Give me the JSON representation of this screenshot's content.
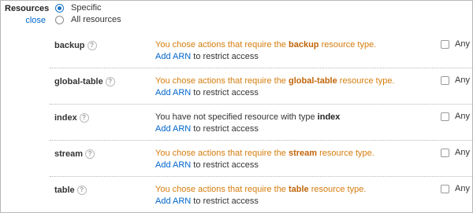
{
  "resources": {
    "label": "Resources",
    "close_label": "close",
    "options": [
      {
        "label": "Specific",
        "selected": true
      },
      {
        "label": "All resources",
        "selected": false
      }
    ],
    "help_glyph": "?",
    "add_arn_label": "Add ARN",
    "add_arn_suffix": " to restrict access",
    "any_label": "Any",
    "colors": {
      "warning_text": "#d57c0d",
      "link": "#0066cc",
      "radio_accent": "#1a73c8"
    },
    "rows": [
      {
        "name": "backup",
        "type": "warning",
        "msg_pre": "You chose actions that require the ",
        "msg_bold": "backup",
        "msg_post": " resource type.",
        "any_checked": false
      },
      {
        "name": "global-table",
        "type": "warning",
        "msg_pre": "You chose actions that require the ",
        "msg_bold": "global-table",
        "msg_post": " resource type.",
        "any_checked": false
      },
      {
        "name": "index",
        "type": "info",
        "msg_pre": "You have not specified resource with type ",
        "msg_bold": "index",
        "msg_post": "",
        "any_checked": false
      },
      {
        "name": "stream",
        "type": "warning",
        "msg_pre": "You chose actions that require the ",
        "msg_bold": "stream",
        "msg_post": " resource type.",
        "any_checked": false
      },
      {
        "name": "table",
        "type": "warning",
        "msg_pre": "You chose actions that require the ",
        "msg_bold": "table",
        "msg_post": " resource type.",
        "any_checked": false
      }
    ]
  }
}
